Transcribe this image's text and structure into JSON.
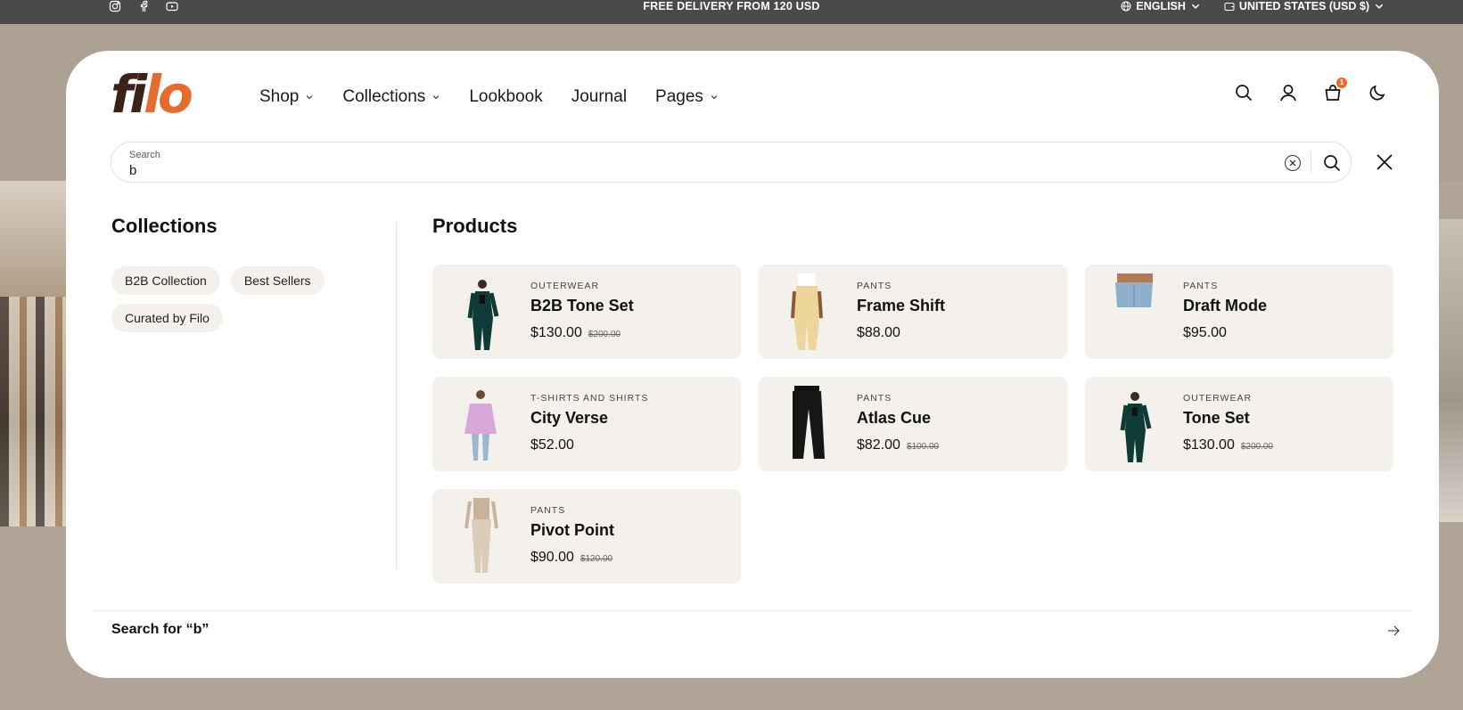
{
  "topbar": {
    "promo": "FREE DELIVERY FROM 120 USD",
    "language": "ENGLISH",
    "currency": "UNITED STATES (USD $)",
    "social_icons": [
      "instagram-icon",
      "facebook-icon",
      "youtube-icon"
    ]
  },
  "header": {
    "logo_part1": "fi",
    "logo_part2": "lo",
    "nav": [
      {
        "label": "Shop",
        "dropdown": true
      },
      {
        "label": "Collections",
        "dropdown": true
      },
      {
        "label": "Lookbook",
        "dropdown": false
      },
      {
        "label": "Journal",
        "dropdown": false
      },
      {
        "label": "Pages",
        "dropdown": true
      }
    ],
    "cart_count": "1",
    "icons": [
      "search-icon",
      "account-icon",
      "cart-icon",
      "moon-icon"
    ]
  },
  "search": {
    "label": "Search",
    "value": "b"
  },
  "collections": {
    "title": "Collections",
    "items": [
      "B2B Collection",
      "Best Sellers",
      "Curated by Filo"
    ]
  },
  "products": {
    "title": "Products",
    "items": [
      {
        "category": "OUTERWEAR",
        "name": "B2B Tone Set",
        "price": "$130.00",
        "old_price": "$200.00"
      },
      {
        "category": "PANTS",
        "name": "Frame Shift",
        "price": "$88.00",
        "old_price": ""
      },
      {
        "category": "PANTS",
        "name": "Draft Mode",
        "price": "$95.00",
        "old_price": ""
      },
      {
        "category": "T-SHIRTS AND SHIRTS",
        "name": "City Verse",
        "price": "$52.00",
        "old_price": ""
      },
      {
        "category": "PANTS",
        "name": "Atlas Cue",
        "price": "$82.00",
        "old_price": "$100.00"
      },
      {
        "category": "OUTERWEAR",
        "name": "Tone Set",
        "price": "$130.00",
        "old_price": "$200.00"
      },
      {
        "category": "PANTS",
        "name": "Pivot Point",
        "price": "$90.00",
        "old_price": "$120.00"
      }
    ]
  },
  "footer": {
    "search_for": "Search for “b”"
  },
  "colors": {
    "accent": "#e56b2e",
    "logo_dark": "#3b2218",
    "card_bg": "#f4f1ec",
    "topbar_bg": "#4a4a4a"
  }
}
